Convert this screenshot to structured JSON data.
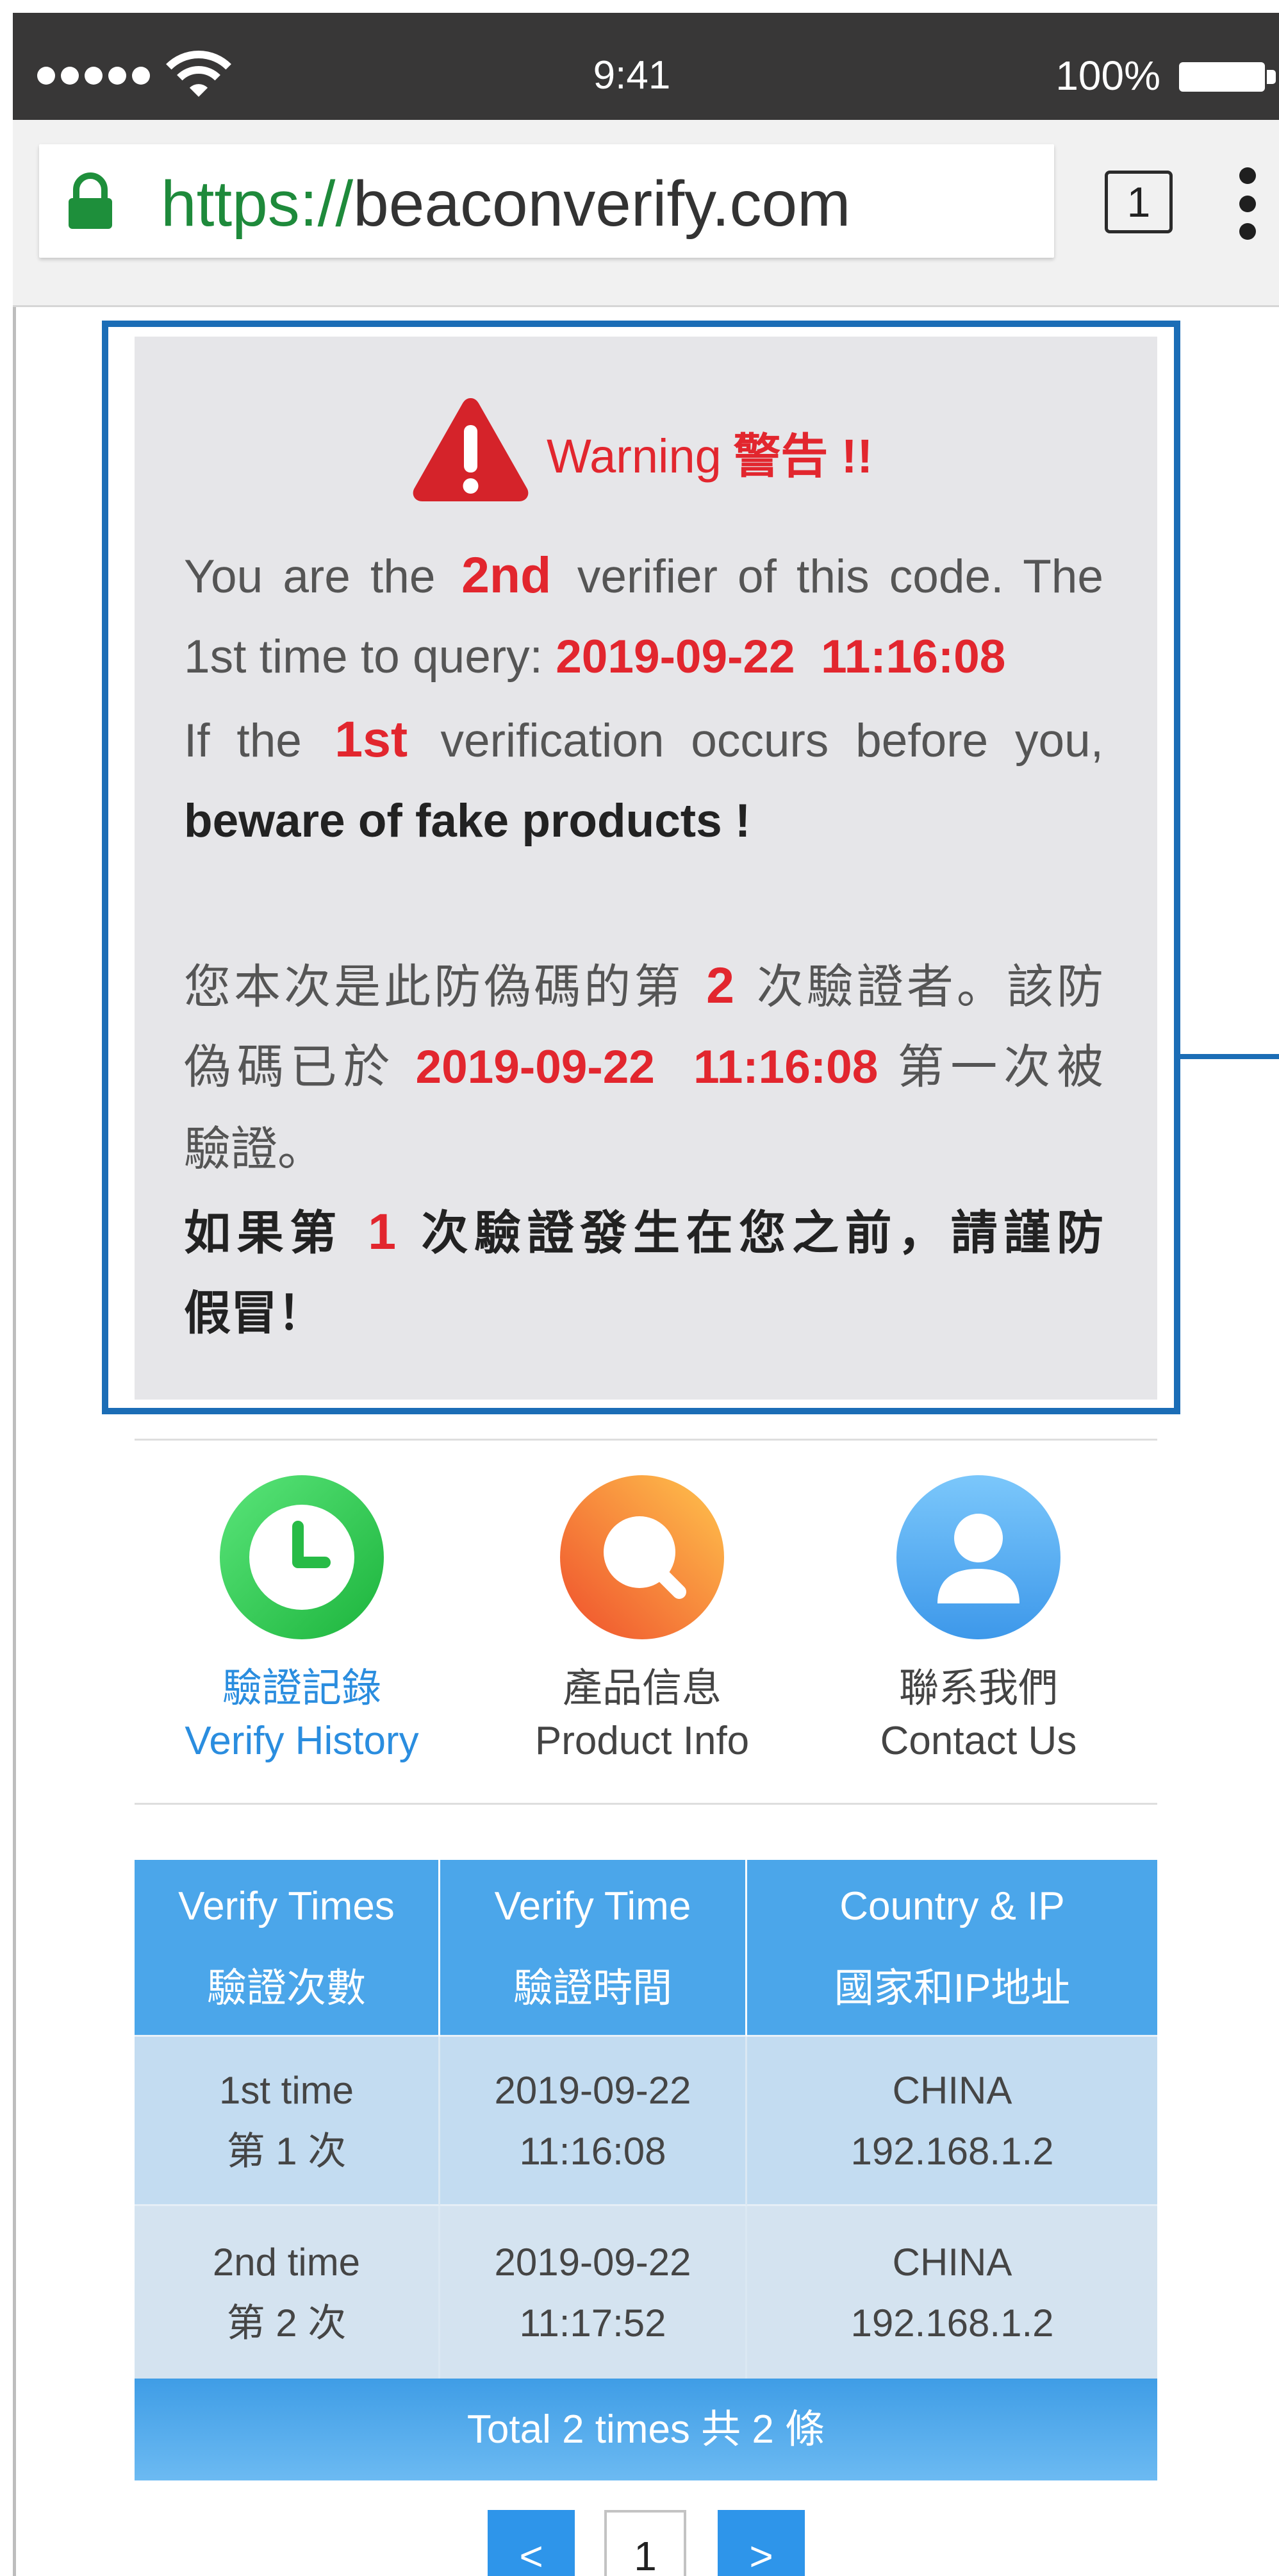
{
  "status_bar": {
    "time": "9:41",
    "battery_text": "100%",
    "signal_strength": 5,
    "icons": {
      "signal": "signal-dots-icon",
      "wifi": "wifi-icon",
      "battery": "battery-icon"
    }
  },
  "browser": {
    "url": {
      "scheme": "https://",
      "host": "beaconverify.com"
    },
    "tab_count": "1",
    "icons": {
      "lock": "lock-icon",
      "tabs": "tab-switcher-icon",
      "menu": "more-vertical-icon"
    }
  },
  "warning": {
    "icon": "warning-triangle-icon",
    "title": "Warning",
    "title_cn": "警告 !!",
    "en_lines": [
      [
        "You are the",
        "2nd",
        "verifier of this code. The"
      ],
      [
        "1st time to query:",
        "2019-09-22  11:16:08"
      ],
      [
        "If the",
        "1st",
        "verification occurs before you,"
      ],
      [
        "beware of fake products !"
      ]
    ],
    "cn_lines": [
      [
        "您本次是此防偽碼的第",
        "2",
        "次驗證者。該防"
      ],
      [
        "偽碼已於",
        "2019-09-22  11:16:08",
        "第一次被"
      ],
      [
        "驗證。"
      ],
      [
        "如果第",
        "1",
        "次驗證發生在您之前，請謹防"
      ],
      [
        "假冒！"
      ]
    ]
  },
  "nav": {
    "items": [
      {
        "label_cn": "驗證記錄",
        "label_en": "Verify History",
        "icon": "clock-icon",
        "active": true
      },
      {
        "label_cn": "產品信息",
        "label_en": "Product Info",
        "icon": "search-icon",
        "active": false
      },
      {
        "label_cn": "聯系我們",
        "label_en": "Contact Us",
        "icon": "user-icon",
        "active": false
      }
    ]
  },
  "history_table": {
    "headers": [
      {
        "en": "Verify Times",
        "cn": "驗證次數"
      },
      {
        "en": "Verify Time",
        "cn": "驗證時間"
      },
      {
        "en": "Country & IP",
        "cn": "國家和IP地址"
      }
    ],
    "rows": [
      {
        "count_en": "1st time",
        "count_cn": "第 1 次",
        "date": "2019-09-22",
        "time": "11:16:08",
        "country": "CHINA",
        "ip": "192.168.1.2"
      },
      {
        "count_en": "2nd time",
        "count_cn": "第 2 次",
        "date": "2019-09-22",
        "time": "11:17:52",
        "country": "CHINA",
        "ip": "192.168.1.2"
      }
    ],
    "footer": "Total 2 times 共 2 條"
  },
  "pagination": {
    "prev": "<",
    "current": "1",
    "next": ">"
  },
  "colors": {
    "warning_red": "#e2262e",
    "annotation_blue": "#1b6db6",
    "accent_blue": "#4ba6ea",
    "nav_active": "#2a8ddf"
  }
}
